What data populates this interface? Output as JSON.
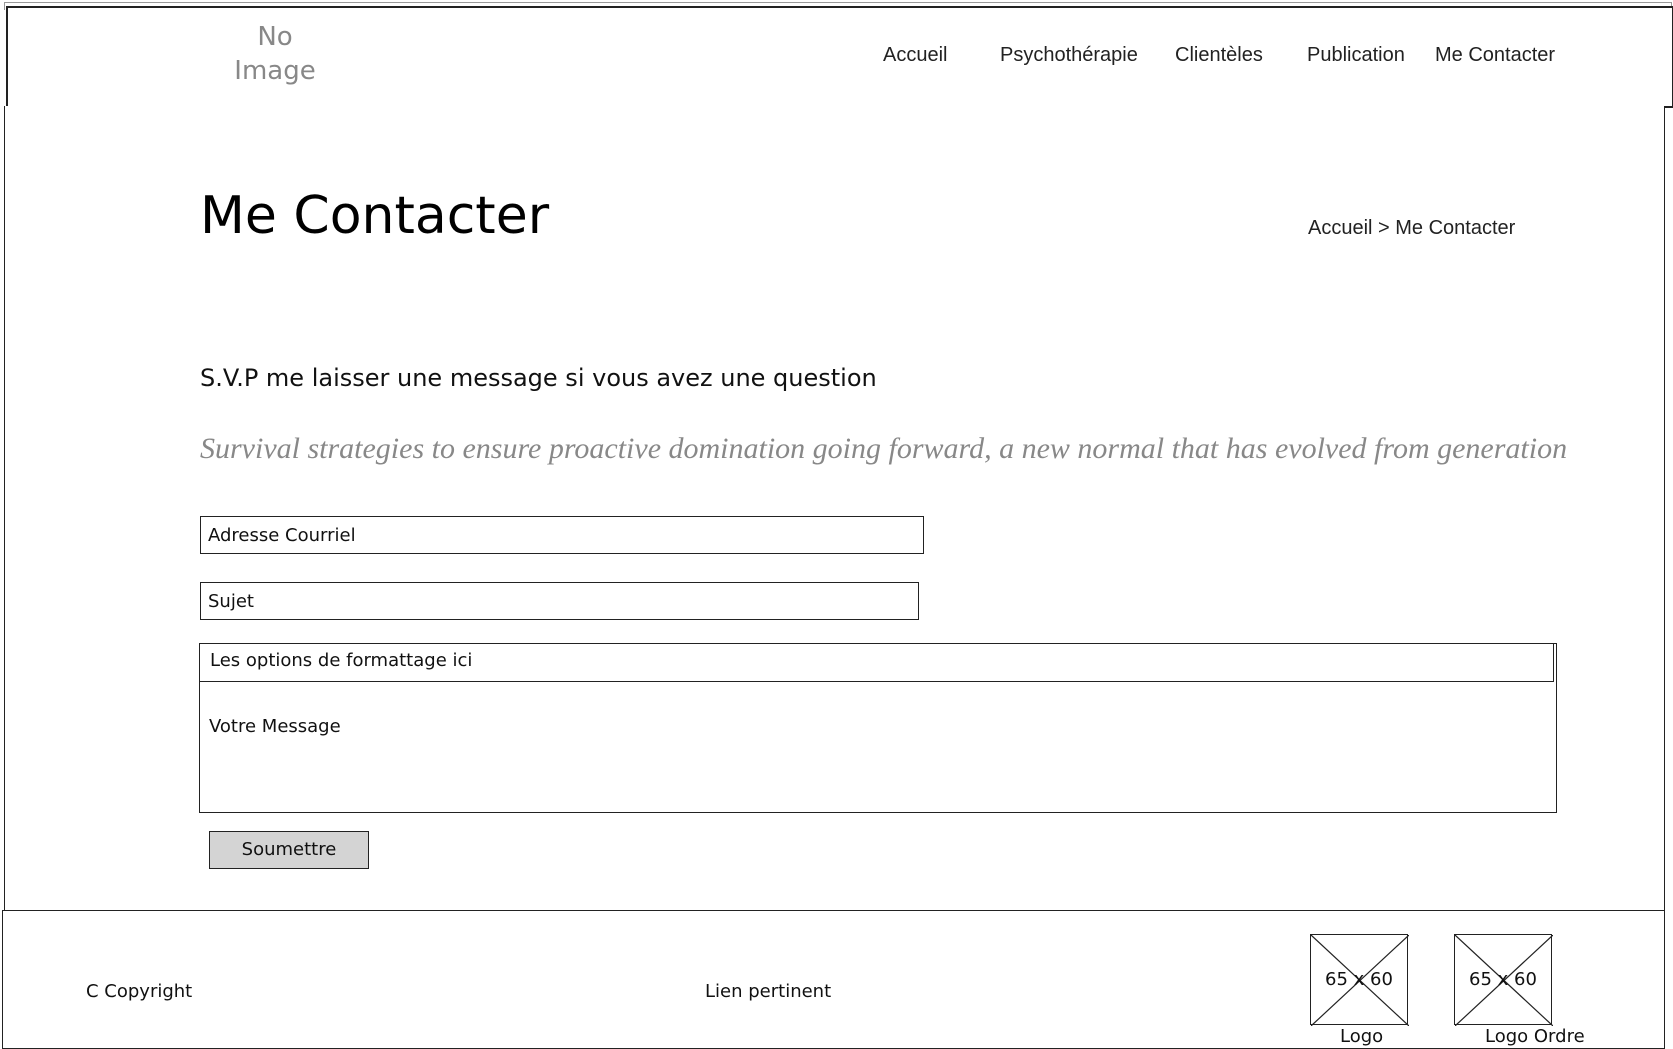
{
  "header": {
    "logo_placeholder_line1": "No",
    "logo_placeholder_line2": "Image",
    "nav": [
      "Accueil",
      "Psychothérapie",
      "Clientèles",
      "Publication",
      "Me Contacter"
    ]
  },
  "title_band": {
    "title": "Me Contacter",
    "breadcrumb": "Accueil > Me Contacter"
  },
  "main": {
    "intro": "S.V.P me laisser une message si vous avez une question",
    "tagline": "Survival strategies to ensure proactive domination going forward, a new normal that has evolved from generation",
    "form": {
      "email_placeholder": "Adresse Courriel",
      "subject_placeholder": "Sujet",
      "format_bar": "Les options de formattage ici",
      "message_placeholder": "Votre Message",
      "submit_label": "Soumettre"
    }
  },
  "footer": {
    "copyright": "C Copyright",
    "link": "Lien pertinent",
    "logos": [
      {
        "dims": "65 x 60",
        "caption": "Logo"
      },
      {
        "dims": "65 x 60",
        "caption": "Logo Ordre"
      }
    ]
  }
}
